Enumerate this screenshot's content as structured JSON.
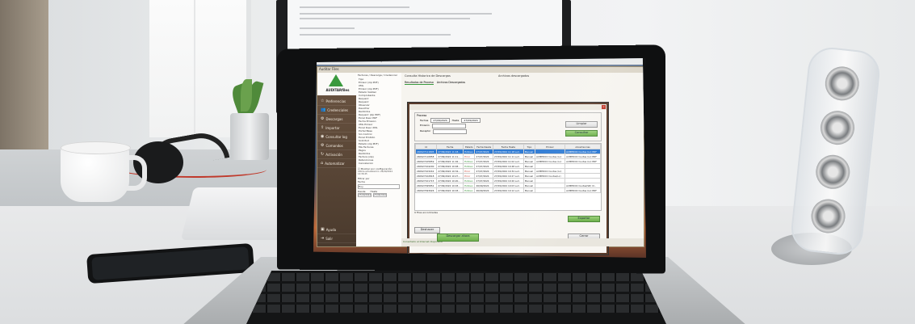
{
  "app": {
    "menubar_text": "Auditar Files   Archivo   Editar   Ver   Ventana   Ayuda",
    "window_title": "Auditar Files",
    "logo_text": "AUDITARfiles",
    "breadcrumb": "Facturas / Descarga / Credencial",
    "toolbar_text": "Consulta Historica de Descargas",
    "archive_label": "Archivos descargados"
  },
  "sidebar": {
    "items": [
      {
        "icon": "star-icon",
        "glyph": "☆",
        "label": "Preferencias"
      },
      {
        "icon": "people-icon",
        "glyph": "👥",
        "label": "Credenciales"
      },
      {
        "icon": "gear-icon",
        "glyph": "⚙",
        "label": "Descargas"
      },
      {
        "icon": "upload-icon",
        "glyph": "⇪",
        "label": "Importar"
      },
      {
        "icon": "check-icon",
        "glyph": "◉",
        "label": "Consultar log"
      },
      {
        "icon": "gear-icon",
        "glyph": "⚙",
        "label": "Comandos"
      },
      {
        "icon": "refresh-icon",
        "glyph": "↻",
        "label": "Activación"
      },
      {
        "icon": "home-icon",
        "glyph": "⌂",
        "label": "Automatizar"
      }
    ],
    "bottom_items": [
      {
        "icon": "help-icon",
        "glyph": "▣",
        "label": "Ayuda"
      },
      {
        "icon": "exit-icon",
        "glyph": "⇥",
        "label": "Salir"
      }
    ]
  },
  "tree": {
    "rows": [
      "Tipo",
      "Emisor (zip PDF)",
      "XML",
      "Emisor (zip PDF)",
      "Estado Validez",
      "Comprobante",
      "Requerir",
      "Requerir",
      "Observar",
      "Descifrar",
      "Recibidos",
      "Requerir (zip PDF)",
      "Excel Desc PDF",
      "Fecha Emision",
      "XML Emisor",
      "Excel Desc XML",
      "Portal Base",
      "Sin Control",
      "Excel Emitido",
      "Solicitud",
      "Estado (zip PDF)",
      "Mis Facturas",
      "Pagos",
      "Recibidos",
      "Factura (zip)",
      "Retenciones",
      "Cancelacion"
    ],
    "checkbox_label": "Mostrar por configuración",
    "footer_text": "Ultima actualización: 26/09/2024 14:36:45",
    "filter_label": "Filtrar por",
    "filter_value": "Fecha",
    "filter_select": "Hoy",
    "from_label": "Desde",
    "to_label": "Hasta",
    "from_value": "27/09/2024",
    "to_value": "27/09/2024"
  },
  "main_tabs": [
    "Resultados de Proceso",
    "Archivos Descargados"
  ],
  "dialog": {
    "title": "",
    "close_glyph": "×",
    "group_label": "Proceso",
    "fecha_label": "Fechas",
    "fecha_from": "27/09/2024",
    "fecha_to_label": "Hasta",
    "fecha_to": "27/09/2024",
    "emisor_label": "Emisión",
    "receptor_label": "Receptor",
    "clear_button": "Limpiar",
    "consult_button": "Consultar",
    "columns": [
      "Id",
      "Fecha",
      "Estado",
      "Fecha Desde",
      "Fecha Hasta",
      "Tipo",
      "Emisor",
      "Advertencias"
    ],
    "rows": [
      {
        "id": "240927111805",
        "fecha": "27/09/2024 11:18...",
        "estado": "Exitoso",
        "desde": "27/07/2024",
        "hasta": "27/09/2024 11:18 a.m.",
        "tipo": "Manual",
        "emisor": "",
        "adv": "ACMEDOO Cuotas (Lx) PDF",
        "selected": true
      },
      {
        "id": "240927110858",
        "fecha": "27/09/2024 11:11...",
        "estado": "Error",
        "desde": "27/07/2024",
        "hasta": "27/09/2024 11:11 a.m.",
        "tipo": "Manual",
        "emisor": "ACMEDOO Cuotas (Lx)",
        "adv": "ACMEDOO Cuotas (Lx) PDF",
        "selected": false
      },
      {
        "id": "240927105859",
        "fecha": "27/09/2024 11:02...",
        "estado": "Exitoso",
        "desde": "27/07/2024",
        "hasta": "27/09/2024 11:02 a.m.",
        "tipo": "Manual",
        "emisor": "ACMEDOO Cuotas (Lx)",
        "adv": "ACMEDOO Cuotas (Lx) PDF",
        "selected": false
      },
      {
        "id": "240927104200",
        "fecha": "27/09/2024 10:48...",
        "estado": "Exitoso",
        "desde": "27/07/2024",
        "hasta": "27/09/2024 10:48 a.m.",
        "tipo": "Manual",
        "emisor": "",
        "adv": "",
        "selected": false
      },
      {
        "id": "240927103242",
        "fecha": "27/09/2024 10:34...",
        "estado": "Error",
        "desde": "27/07/2024",
        "hasta": "27/09/2024 10:34 a.m.",
        "tipo": "Manual",
        "emisor": "ACMEDOO Cuotas (Lx)",
        "adv": "",
        "selected": false
      },
      {
        "id": "240927102818",
        "fecha": "27/09/2024 10:27...",
        "estado": "Error",
        "desde": "27/07/2024",
        "hasta": "27/09/2024 10:27 a.m.",
        "tipo": "Manual",
        "emisor": "ACMEDOO Cuotas(Lx)",
        "adv": "",
        "selected": false
      },
      {
        "id": "240927101715",
        "fecha": "27/09/2024 10:20...",
        "estado": "Exitoso",
        "desde": "27/07/2024",
        "hasta": "27/09/2024 10:20 a.m.",
        "tipo": "Manual",
        "emisor": "",
        "adv": "",
        "selected": false
      },
      {
        "id": "240927095852",
        "fecha": "27/09/2024 10:03...",
        "estado": "Exitoso",
        "desde": "26/09/2024",
        "hasta": "27/09/2024 10:03 a.m.",
        "tipo": "Manual",
        "emisor": "",
        "adv": "ACMEDOO Cuotas(SD) Cl..",
        "selected": false
      },
      {
        "id": "240927093026",
        "fecha": "27/09/2024 10:03...",
        "estado": "Exitoso",
        "desde": "26/09/2024",
        "hasta": "27/09/2024 10:12 a.m.",
        "tipo": "Manual",
        "emisor": "",
        "adv": "ACMEDOO Cuotas (Lx) PDF",
        "selected": false
      }
    ],
    "records_text": "9 Filas encontradas",
    "export_button": "Exportar",
    "close_button": "Cerrar",
    "back_button": "Deshacer"
  },
  "bottom": {
    "download_button": "Descargar ahora",
    "status_text": "Conectado al Internet disponible"
  },
  "colors": {
    "sidebar": "#5a4535",
    "accent_green": "#3a9a3e",
    "selected_row": "#2d7ad4",
    "dialog_border": "#5a3b2a"
  }
}
